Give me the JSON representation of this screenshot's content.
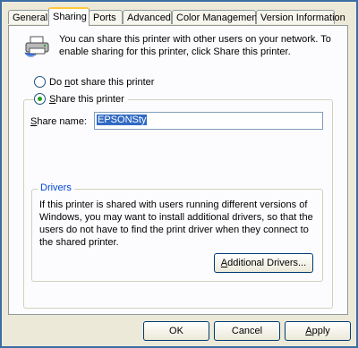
{
  "tabs": [
    {
      "label": "General"
    },
    {
      "label": "Sharing"
    },
    {
      "label": "Ports"
    },
    {
      "label": "Advanced"
    },
    {
      "label": "Color Management"
    },
    {
      "label": "Version Information"
    }
  ],
  "info_text": "You can share this printer with other users on your network. To enable sharing for this printer, click Share this printer.",
  "radio_no_share": {
    "label_prefix": "Do ",
    "label_accel": "n",
    "label_rest": "ot share this printer",
    "checked": false
  },
  "radio_share": {
    "label_accel": "S",
    "label_rest": "hare this printer",
    "checked": true
  },
  "share_name": {
    "label_accel": "S",
    "label_rest": "hare name:",
    "value": "EPSONSty"
  },
  "drivers": {
    "legend": "Drivers",
    "text": "If this printer is shared with users running different versions of Windows, you may want to install additional drivers, so that the users do not have to find the print driver when they connect to the shared printer.",
    "button_accel": "A",
    "button_rest": "dditional Drivers..."
  },
  "buttons": {
    "ok": "OK",
    "cancel": "Cancel",
    "apply_accel": "A",
    "apply_rest": "pply"
  },
  "colors": {
    "accent_tab": "#ffc83c",
    "radio_dot": "#21a121",
    "selection": "#316ac5"
  },
  "icons": {
    "printer": "printer-share-icon"
  }
}
